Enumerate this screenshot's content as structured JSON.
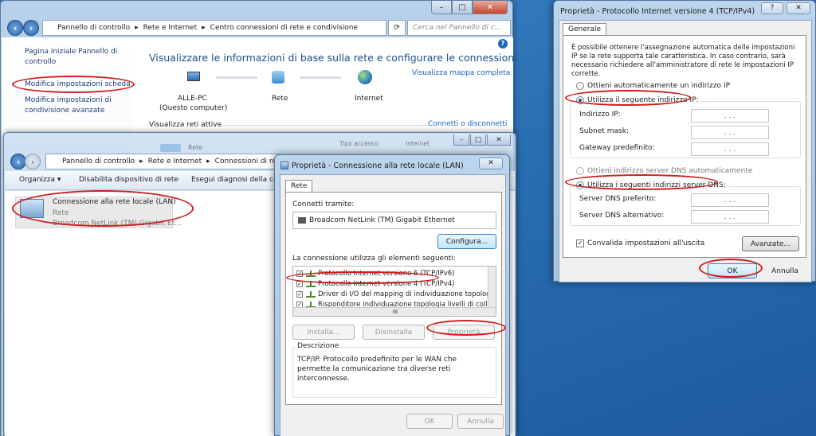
{
  "main_window": {
    "breadcrumb": [
      "Pannello di controllo",
      "Rete e Internet",
      "Centro connessioni di rete e condivisione"
    ],
    "search_placeholder": "Cerca nel Pannello di c...",
    "left_links": [
      "Pagina iniziale Pannello di controllo",
      "Modifica impostazioni scheda",
      "Modifica impostazioni di condivisione avanzate"
    ],
    "heading": "Visualizzare le informazioni di base sulla rete e configurare le connessioni",
    "map_link": "Visualizza mappa completa",
    "map_nodes": {
      "pc_name": "ALLE-PC",
      "pc_sub": "(Questo computer)",
      "network": "Rete",
      "internet": "Internet"
    },
    "active_networks": "Visualizza reti attive",
    "connect_link": "Connetti o disconnetti",
    "obscured": {
      "rete": "Rete",
      "tipo": "Tipo accesso:",
      "internet": "Internet"
    }
  },
  "connections_window": {
    "breadcrumb": [
      "Pannello di controllo",
      "Rete e Internet",
      "Connessioni di re"
    ],
    "toolbar": [
      "Organizza ▾",
      "Disabilita dispositivo di rete",
      "Esegui diagnosi della co"
    ],
    "adapter": {
      "name": "Connessione alla rete locale (LAN)",
      "network": "Rete",
      "device": "Broadcom NetLink (TM) Gigabit Et..."
    }
  },
  "lan_dialog": {
    "title": "Proprietà - Connessione alla rete locale (LAN)",
    "tab": "Rete",
    "connect_using_label": "Connetti tramite:",
    "device": "Broadcom NetLink (TM) Gigabit Ethernet",
    "configure_button": "Configura...",
    "items_label": "La connessione utilizza gli elementi seguenti:",
    "items": [
      "Protocollo Internet versione 6 (TCP/IPv6)",
      "Protocollo Internet versione 4 (TCP/IPv4)",
      "Driver di I/O del mapping di individuazione topologia livelli",
      "Risponditore individuazione topologia livelli di collegamen"
    ],
    "scroll_mid": "III",
    "buttons": {
      "install": "Installa...",
      "uninstall": "Disinstalla",
      "properties": "Proprietà"
    },
    "description_label": "Descrizione",
    "description": "TCP/IP. Protocollo predefinito per le WAN che permette la comunicazione tra diverse reti interconnesse.",
    "ok": "OK",
    "cancel": "Annulla"
  },
  "ipv4_dialog": {
    "title": "Proprietà - Protocollo Internet versione 4 (TCP/IPv4)",
    "help": "?",
    "tab": "Generale",
    "intro": "È possibile ottenere l'assegnazione automatica delle impostazioni IP se la rete supporta tale caratteristica. In caso contrario, sarà necessario richiedere all'amministratore di rete le impostazioni IP corrette.",
    "radio_auto_ip": "Ottieni automaticamente un indirizzo IP",
    "radio_static_ip": "Utilizza il seguente indirizzo IP:",
    "ip_label": "Indirizzo IP:",
    "mask_label": "Subnet mask:",
    "gateway_label": "Gateway predefinito:",
    "radio_auto_dns": "Ottieni indirizzo server DNS automaticamente",
    "radio_static_dns": "Utilizza i seguenti indirizzi server DNS:",
    "dns_pref_label": "Server DNS preferito:",
    "dns_alt_label": "Server DNS alternativo:",
    "ip_dots": ". . .",
    "validate": "Convalida impostazioni all'uscita",
    "advanced": "Avanzate...",
    "ok": "OK",
    "cancel": "Annulla"
  },
  "colors": {
    "highlight": "#d11a1a",
    "link": "#1565c0"
  }
}
